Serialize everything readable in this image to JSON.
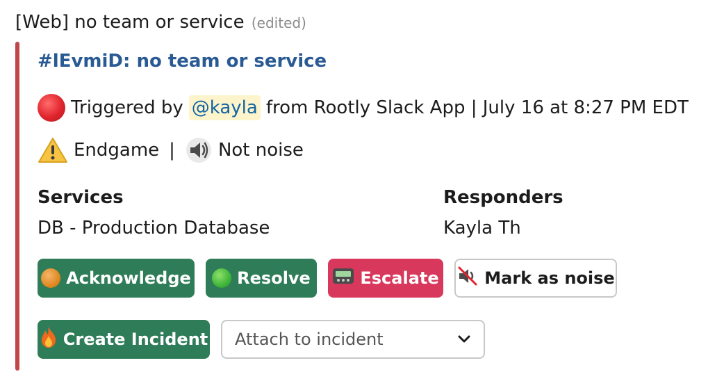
{
  "message": {
    "title": "[Web] no team or service",
    "edited": "(edited)"
  },
  "alert": {
    "link_text": "#lEvmiD: no team or service",
    "trigger_prefix": "Triggered by",
    "mention": "@kayla",
    "trigger_suffix": "from Rootly Slack App | July 16 at 8:27 PM EDT",
    "environment": "Endgame",
    "separator": "|",
    "noise_status": "Not noise"
  },
  "fields": {
    "services_label": "Services",
    "services_value": "DB - Production Database",
    "responders_label": "Responders",
    "responders_value": "Kayla Th"
  },
  "actions": {
    "acknowledge": "Acknowledge",
    "resolve": "Resolve",
    "escalate": "Escalate",
    "mark_noise": "Mark as noise",
    "create_incident": "Create Incident",
    "attach_placeholder": "Attach to incident"
  },
  "icons": {
    "trigger": "red-circle-icon",
    "environment": "warning-icon",
    "noise": "speaker-icon",
    "acknowledge": "orange-circle-icon",
    "resolve": "green-circle-icon",
    "escalate": "pager-icon",
    "mark_noise": "muted-speaker-icon",
    "create_incident": "fire-icon",
    "attach_dropdown": "chevron-down-icon"
  },
  "colors": {
    "attachment_bar": "#c04747",
    "link": "#2a5a94",
    "green_button": "#2f7d58",
    "red_button": "#d8385c",
    "mention_bg": "#fdf4cc"
  }
}
